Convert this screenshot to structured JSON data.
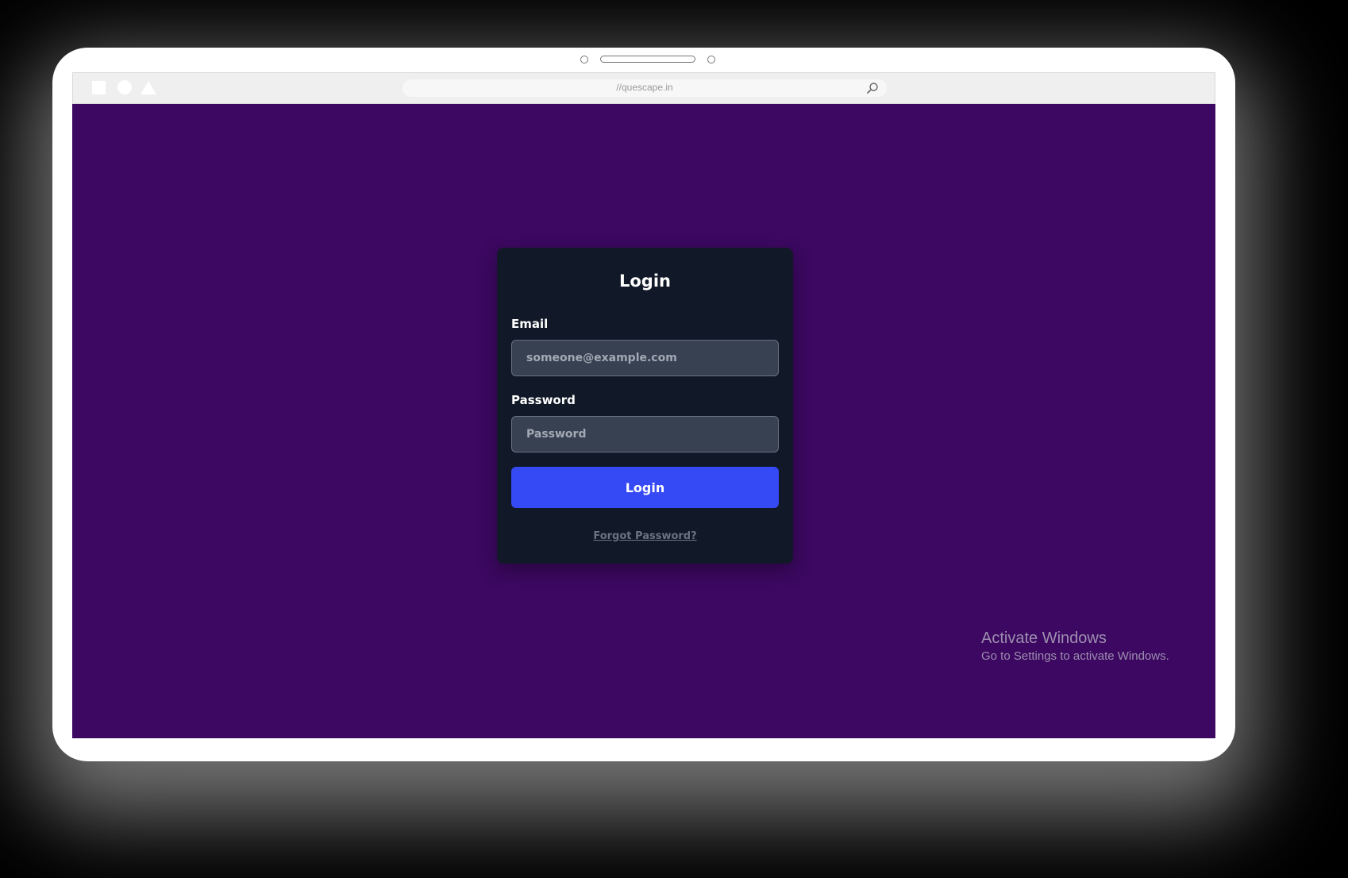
{
  "browser": {
    "url": "//quescape.in"
  },
  "login": {
    "title": "Login",
    "email_label": "Email",
    "email_placeholder": "someone@example.com",
    "password_label": "Password",
    "password_placeholder": "Password",
    "submit_label": "Login",
    "forgot_label": "Forgot Password?"
  },
  "watermark": {
    "title": "Activate Windows",
    "subtitle": "Go to Settings to activate Windows."
  },
  "icons": {
    "search": "search-icon",
    "square": "square-shape-icon",
    "circle": "circle-shape-icon",
    "triangle": "triangle-shape-icon"
  },
  "colors": {
    "page_background": "#3c0861",
    "card_background": "#111827",
    "input_background": "#374151",
    "button_background": "#3549f5"
  }
}
